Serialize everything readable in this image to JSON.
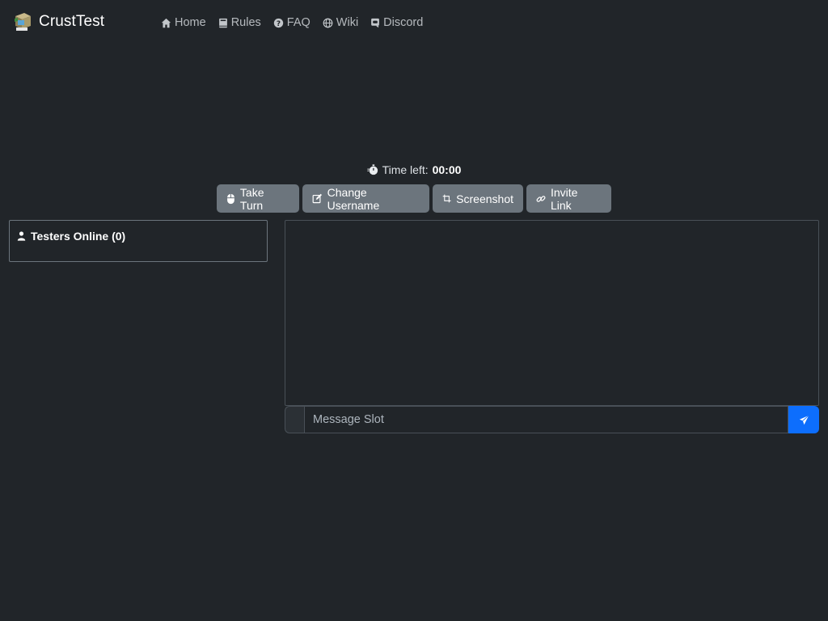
{
  "brand": {
    "name": "CrustTest"
  },
  "nav": {
    "items": [
      {
        "label": "Home",
        "icon": "house-icon"
      },
      {
        "label": "Rules",
        "icon": "book-icon"
      },
      {
        "label": "FAQ",
        "icon": "question-circle-icon"
      },
      {
        "label": "Wiki",
        "icon": "globe-icon"
      },
      {
        "label": "Discord",
        "icon": "discord-icon"
      }
    ]
  },
  "timer": {
    "label": "Time left:",
    "value": "00:00",
    "icon": "stopwatch-icon"
  },
  "buttons": {
    "take_turn": "Take Turn",
    "change_username": "Change Username",
    "screenshot": "Screenshot",
    "invite_link": "Invite Link"
  },
  "users": {
    "header": "Testers Online (0)",
    "icon": "person-icon"
  },
  "chat": {
    "placeholder": "Message Slot",
    "send_icon": "send-icon"
  },
  "colors": {
    "background": "#212529",
    "button": "#6c757d",
    "accent": "#0d6efd"
  }
}
